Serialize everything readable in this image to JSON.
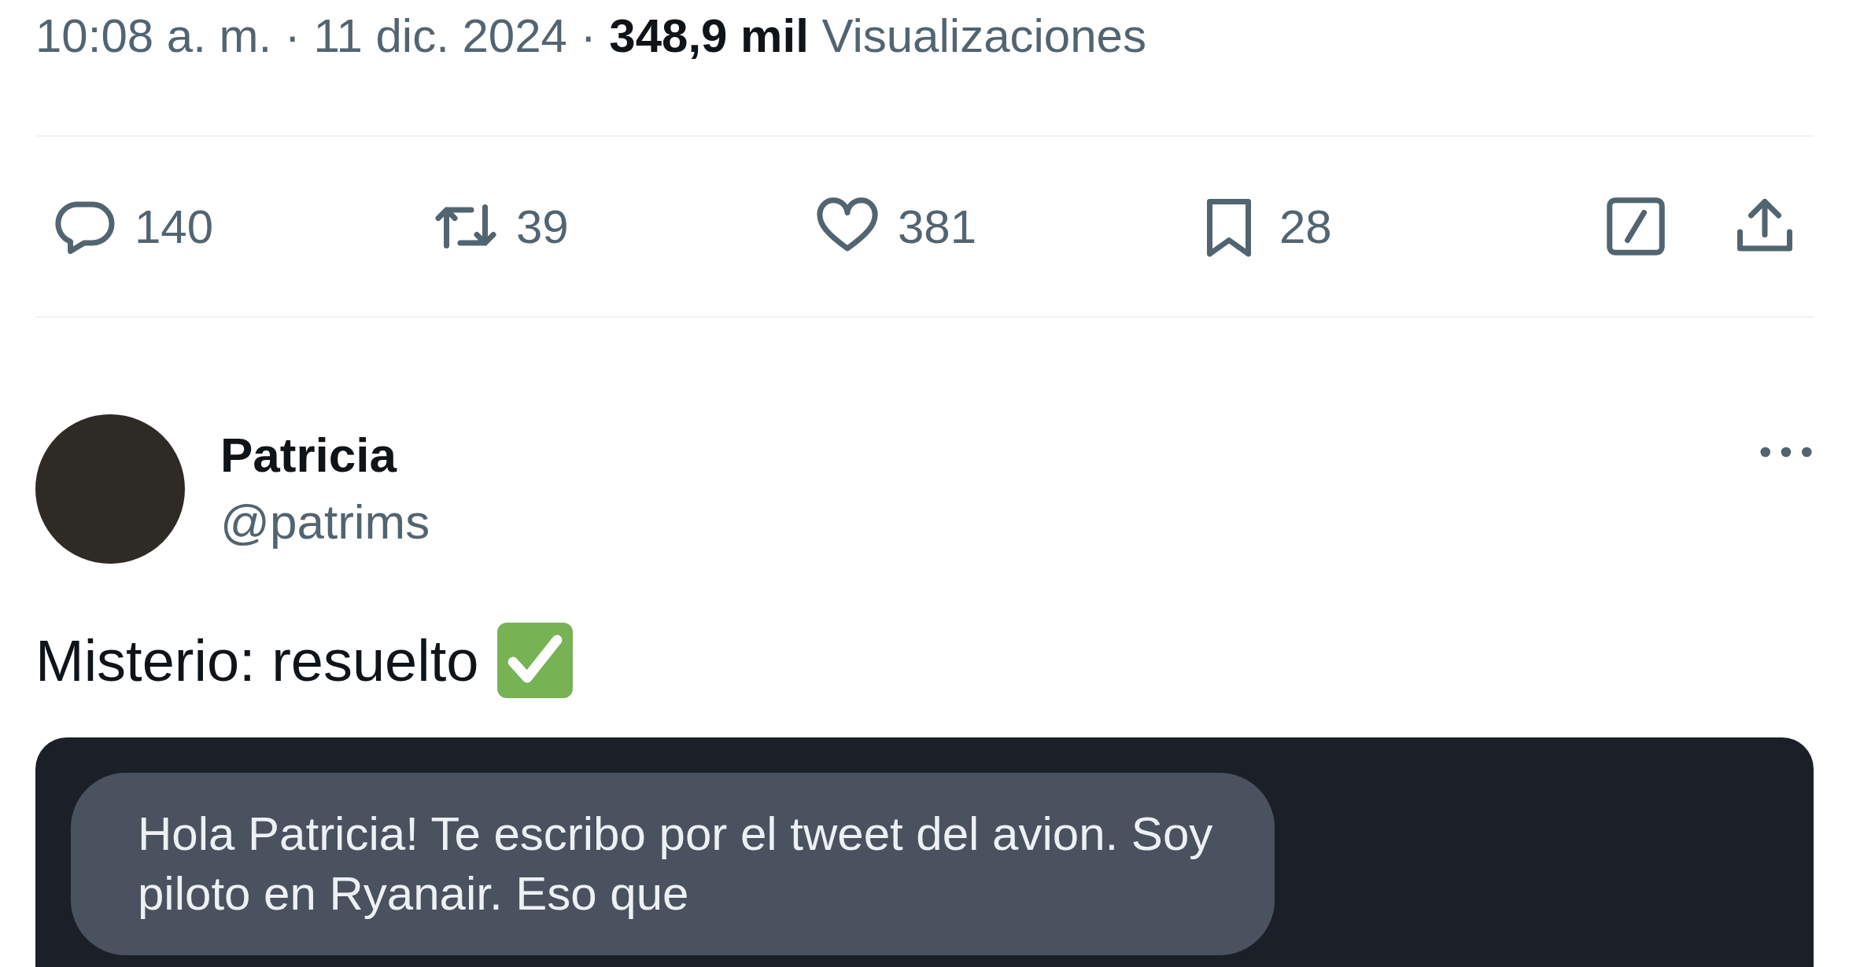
{
  "tweet_meta": "10:08 a. m. · 11 dic. 2024 · **348,9 mil** Visualizaciones",
  "actions": [
    {
      "kind": "reply",
      "count": "140"
    },
    {
      "kind": "repost",
      "count": "39"
    },
    {
      "kind": "like",
      "count": "381"
    },
    {
      "kind": "bookmark",
      "count": "28"
    },
    {
      "kind": "grok"
    },
    {
      "kind": "share"
    }
  ],
  "reply": {
    "name": "Patricia",
    "handle": "@patrims",
    "text": "Misterio: resuelto",
    "message": "Hola Patricia! Te escribo por el tweet del avion. Soy piloto en Ryanair. Eso que"
  }
}
